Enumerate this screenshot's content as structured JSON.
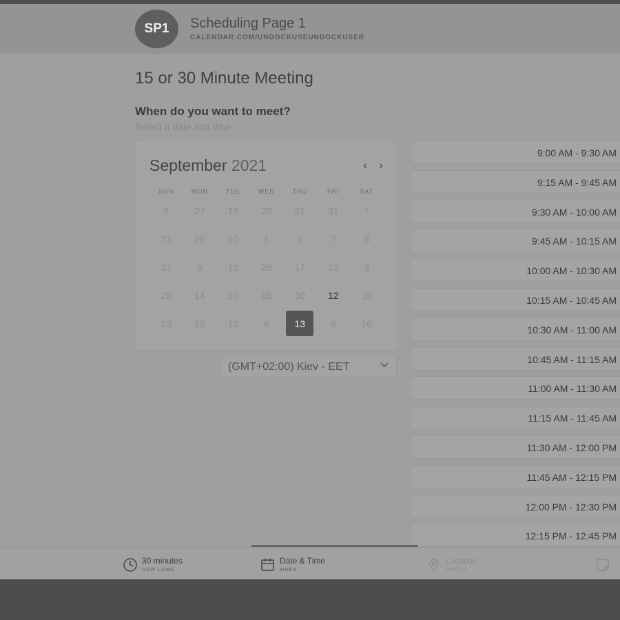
{
  "header": {
    "avatar": "SP1",
    "title": "Scheduling Page 1",
    "url": "CALENDAR.COM/UNDOCKUSEUNDOCKUSER"
  },
  "meeting": {
    "title": "15 or 30 Minute Meeting",
    "question": "When do you want to meet?",
    "hint": "Select a date and time"
  },
  "calendar": {
    "month": "September",
    "year": "2021",
    "weekdays": [
      "SUN",
      "MON",
      "TUE",
      "WED",
      "THU",
      "FRI",
      "SAT"
    ],
    "rows": [
      [
        "6",
        "27",
        "15",
        "28",
        "21",
        "31",
        "7"
      ],
      [
        "21",
        "26",
        "10",
        "1",
        "5",
        "7",
        "8"
      ],
      [
        "31",
        "6",
        "12",
        "26",
        "17",
        "13",
        "3"
      ],
      [
        "28",
        "14",
        "10",
        "16",
        "30",
        "12",
        "16"
      ],
      [
        "23",
        "15",
        "12",
        "6",
        "13",
        "8",
        "16"
      ]
    ],
    "enabled": [
      [
        3,
        5
      ]
    ],
    "selected": [
      4,
      4
    ]
  },
  "timezone": "(GMT+02:00) Kiev - EET",
  "slots": [
    "9:00 AM - 9:30 AM",
    "9:15 AM - 9:45 AM",
    "9:30 AM - 10:00 AM",
    "9:45 AM - 10:15 AM",
    "10:00 AM - 10:30 AM",
    "10:15 AM - 10:45 AM",
    "10:30 AM - 11:00 AM",
    "10:45 AM - 11:15 AM",
    "11:00 AM - 11:30 AM",
    "11:15 AM - 11:45 AM",
    "11:30 AM - 12:00 PM",
    "11:45 AM - 12:15 PM",
    "12:00 PM - 12:30 PM",
    "12:15 PM - 12:45 PM"
  ],
  "footer": {
    "duration": {
      "label": "30 minutes",
      "sub": "HOW LONG"
    },
    "datetime": {
      "label": "Date & Time",
      "sub": "WHEN"
    },
    "location": {
      "label": "Location",
      "sub": "WHERE"
    }
  },
  "icons": {
    "clock": "clock-icon",
    "calendar": "calendar-icon",
    "location": "location-pin-icon",
    "note": "note-icon",
    "prev": "chevron-left-icon",
    "next": "chevron-right-icon",
    "dropdown": "chevron-down-icon"
  }
}
